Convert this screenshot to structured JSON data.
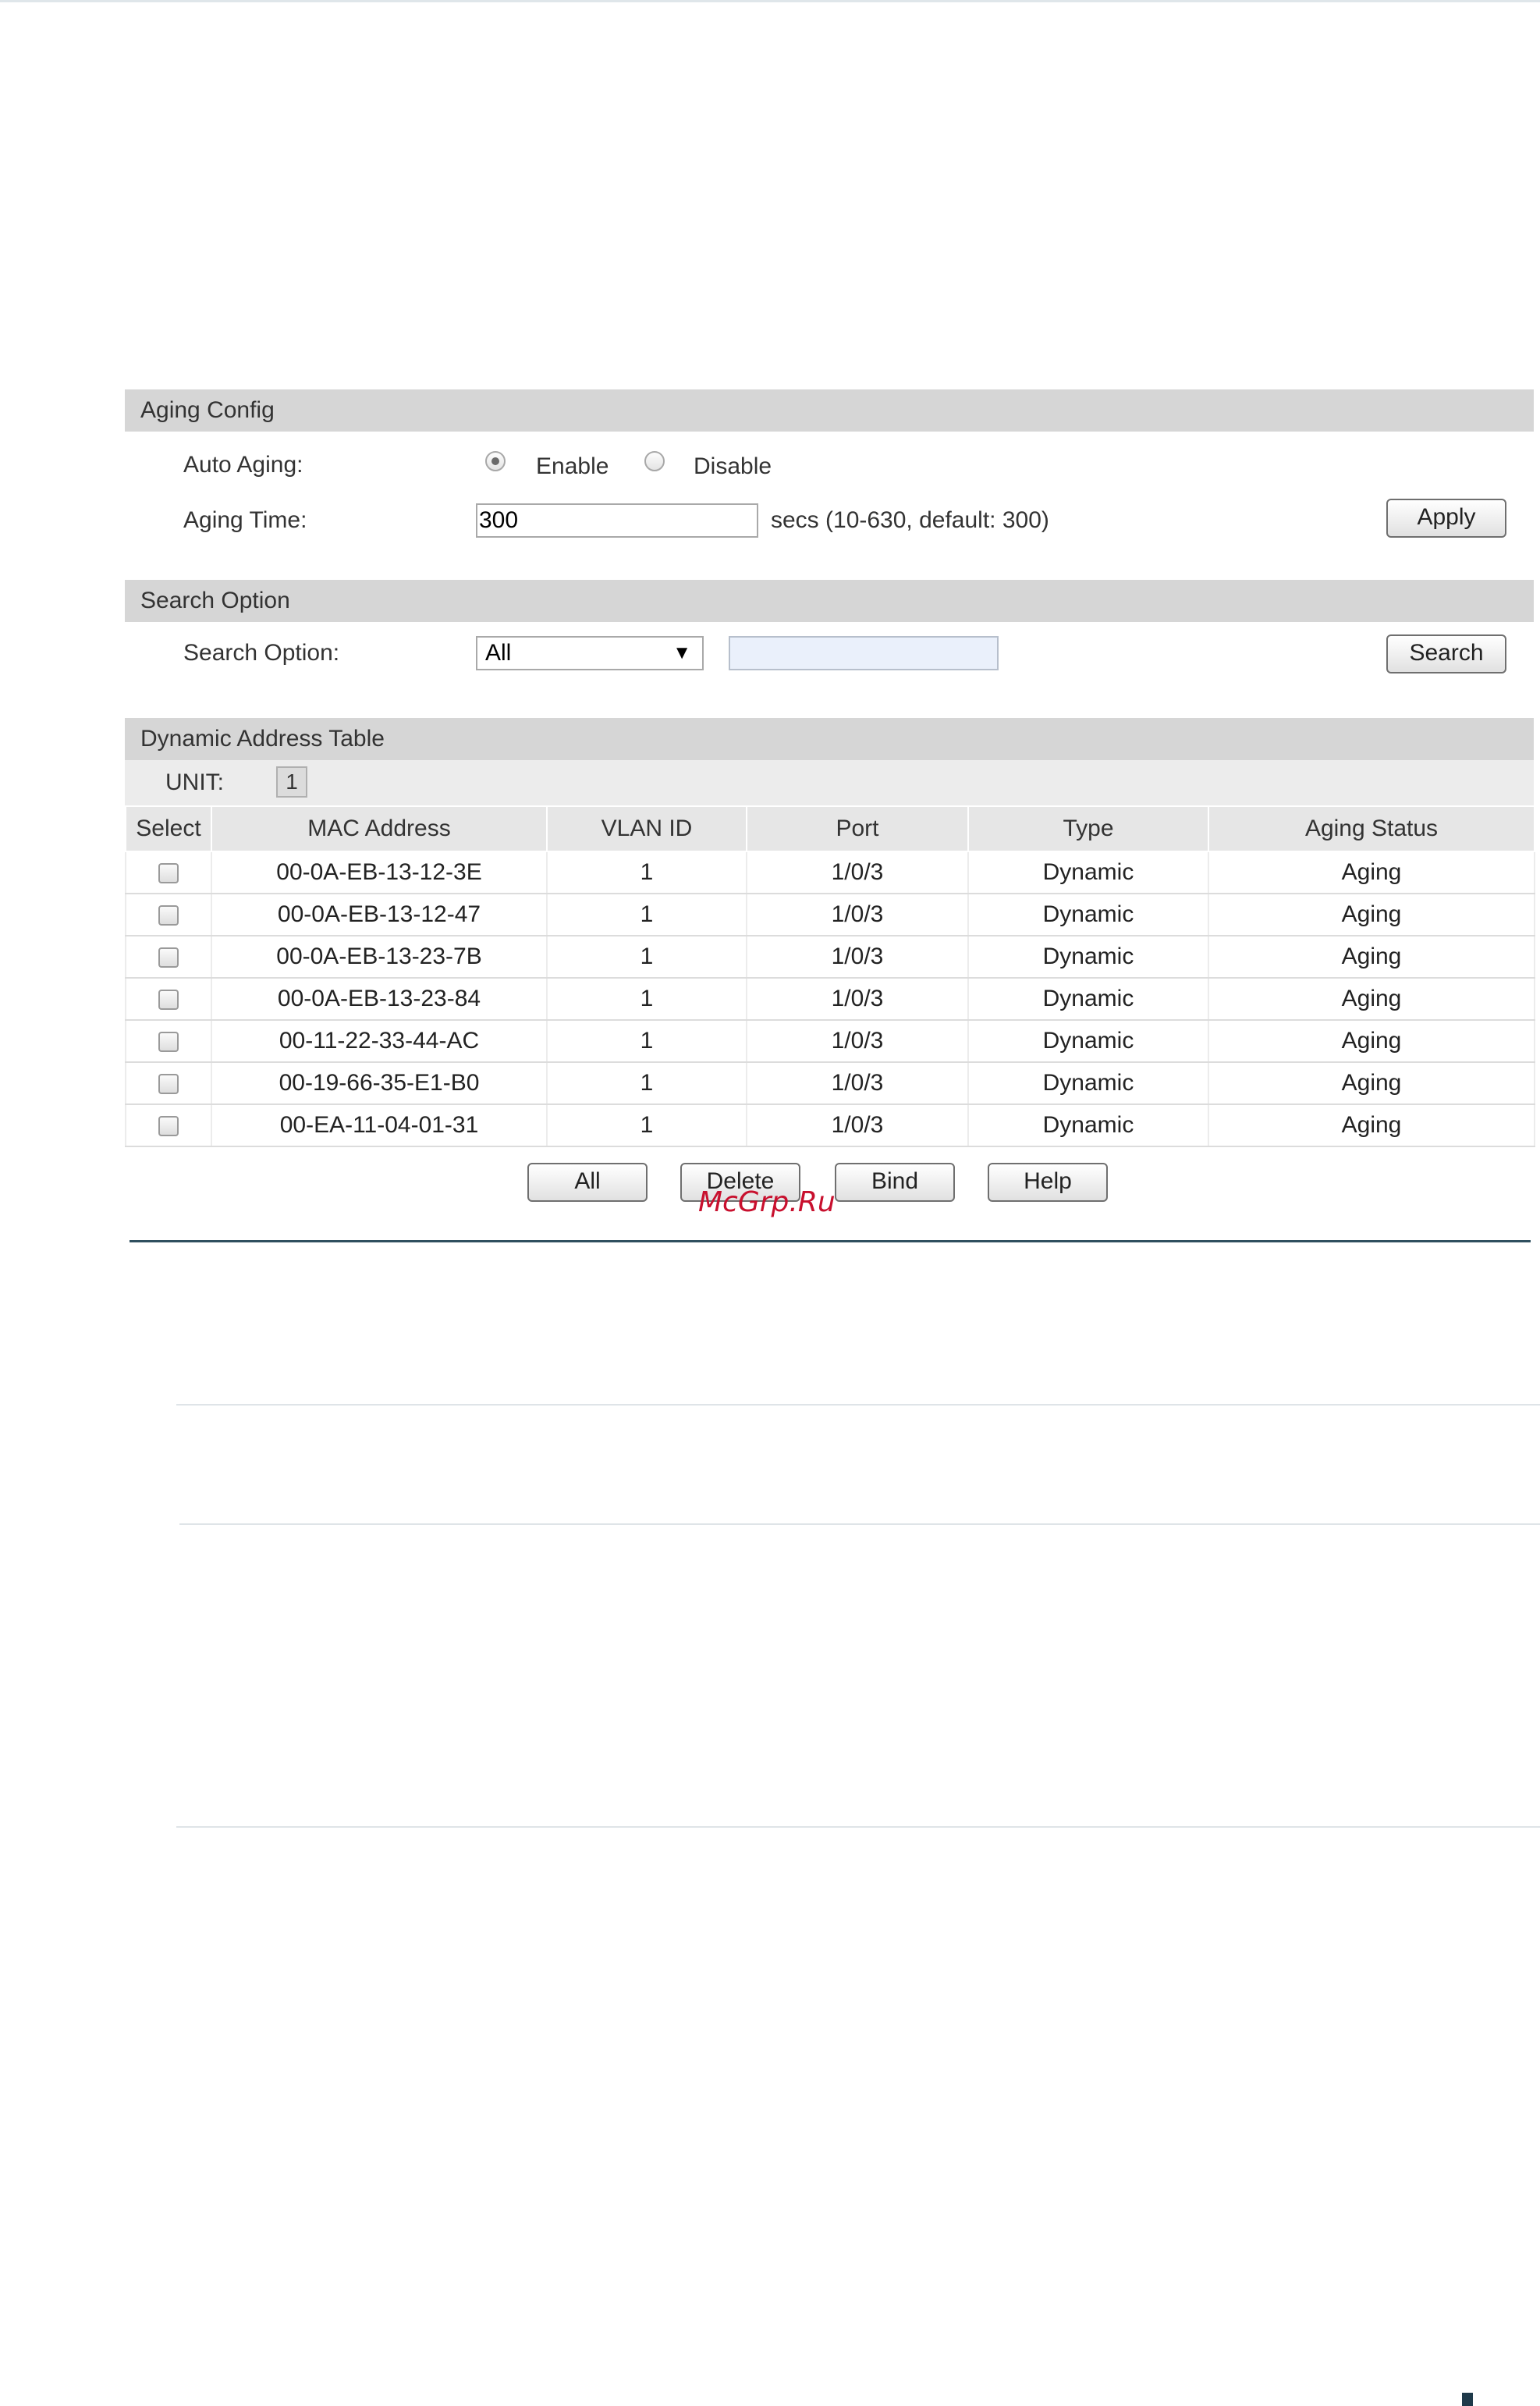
{
  "aging_config": {
    "title": "Aging Config",
    "auto_aging_label": "Auto Aging:",
    "enable_label": "Enable",
    "disable_label": "Disable",
    "auto_aging_value": "Enable",
    "aging_time_label": "Aging Time:",
    "aging_time_value": "300",
    "aging_time_hint": "secs (10-630, default: 300)",
    "apply_label": "Apply"
  },
  "search_option": {
    "title": "Search Option",
    "label": "Search Option:",
    "selected": "All",
    "search_value": "",
    "search_label": "Search"
  },
  "dynamic_table": {
    "title": "Dynamic Address Table",
    "unit_label": "UNIT:",
    "unit_value": "1",
    "columns": [
      "Select",
      "MAC Address",
      "VLAN ID",
      "Port",
      "Type",
      "Aging Status"
    ],
    "rows": [
      {
        "mac": "00-0A-EB-13-12-3E",
        "vlan": "1",
        "port": "1/0/3",
        "type": "Dynamic",
        "status": "Aging"
      },
      {
        "mac": "00-0A-EB-13-12-47",
        "vlan": "1",
        "port": "1/0/3",
        "type": "Dynamic",
        "status": "Aging"
      },
      {
        "mac": "00-0A-EB-13-23-7B",
        "vlan": "1",
        "port": "1/0/3",
        "type": "Dynamic",
        "status": "Aging"
      },
      {
        "mac": "00-0A-EB-13-23-84",
        "vlan": "1",
        "port": "1/0/3",
        "type": "Dynamic",
        "status": "Aging"
      },
      {
        "mac": "00-11-22-33-44-AC",
        "vlan": "1",
        "port": "1/0/3",
        "type": "Dynamic",
        "status": "Aging"
      },
      {
        "mac": "00-19-66-35-E1-B0",
        "vlan": "1",
        "port": "1/0/3",
        "type": "Dynamic",
        "status": "Aging"
      },
      {
        "mac": "00-EA-11-04-01-31",
        "vlan": "1",
        "port": "1/0/3",
        "type": "Dynamic",
        "status": "Aging"
      }
    ],
    "buttons": {
      "all": "All",
      "delete": "Delete",
      "bind": "Bind",
      "help": "Help"
    }
  },
  "watermark": "McGrp.Ru",
  "colors": {
    "header_bg": "#d6d6d6",
    "divider": "#2f4f5f",
    "watermark": "#c8102e"
  }
}
